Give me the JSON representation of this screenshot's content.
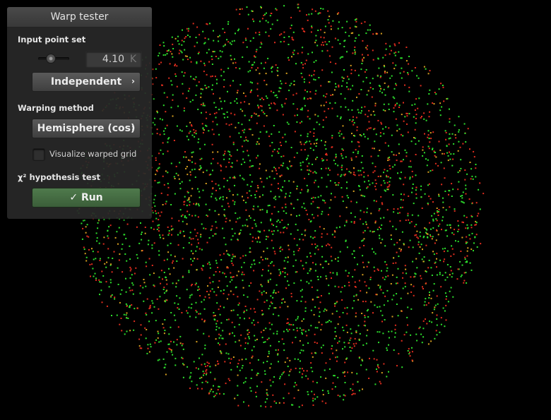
{
  "panel": {
    "title": "Warp tester",
    "input_section_label": "Input point set",
    "point_count_value": "4.10",
    "point_count_unit": "K",
    "point_set_button": "Independent",
    "warping_section_label": "Warping method",
    "warping_method_button": "Hemisphere (cos)",
    "visualize_grid_label": "Visualize warped grid",
    "visualize_grid_checked": false,
    "hypothesis_section_label": "χ² hypothesis test",
    "run_button": "Run",
    "run_icon": "check-icon",
    "chevron_icon": "chevron-right-icon"
  },
  "plot": {
    "point_colors": [
      "#2de02d",
      "#e02d1e",
      "#d8a020"
    ],
    "background": "#000000"
  }
}
